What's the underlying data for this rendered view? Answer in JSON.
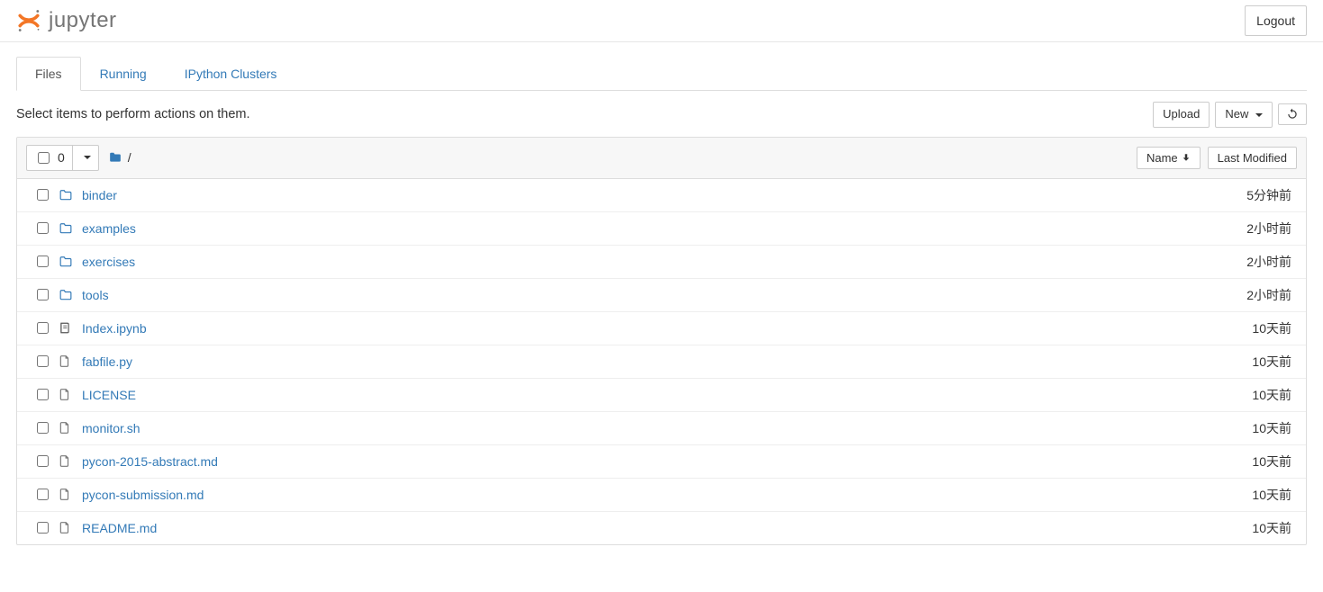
{
  "header": {
    "brand": "jupyter",
    "logout_label": "Logout"
  },
  "tabs": {
    "files": "Files",
    "running": "Running",
    "clusters": "IPython Clusters"
  },
  "actions": {
    "hint": "Select items to perform actions on them.",
    "upload": "Upload",
    "new": "New"
  },
  "list_header": {
    "selected_count": "0",
    "breadcrumb_sep": "/",
    "name_col": "Name",
    "modified_col": "Last Modified"
  },
  "items": [
    {
      "type": "folder",
      "name": "binder",
      "modified": "5分钟前"
    },
    {
      "type": "folder",
      "name": "examples",
      "modified": "2小时前"
    },
    {
      "type": "folder",
      "name": "exercises",
      "modified": "2小时前"
    },
    {
      "type": "folder",
      "name": "tools",
      "modified": "2小时前"
    },
    {
      "type": "notebook",
      "name": "Index.ipynb",
      "modified": "10天前"
    },
    {
      "type": "file",
      "name": "fabfile.py",
      "modified": "10天前"
    },
    {
      "type": "file",
      "name": "LICENSE",
      "modified": "10天前"
    },
    {
      "type": "file",
      "name": "monitor.sh",
      "modified": "10天前"
    },
    {
      "type": "file",
      "name": "pycon-2015-abstract.md",
      "modified": "10天前"
    },
    {
      "type": "file",
      "name": "pycon-submission.md",
      "modified": "10天前"
    },
    {
      "type": "file",
      "name": "README.md",
      "modified": "10天前"
    }
  ]
}
